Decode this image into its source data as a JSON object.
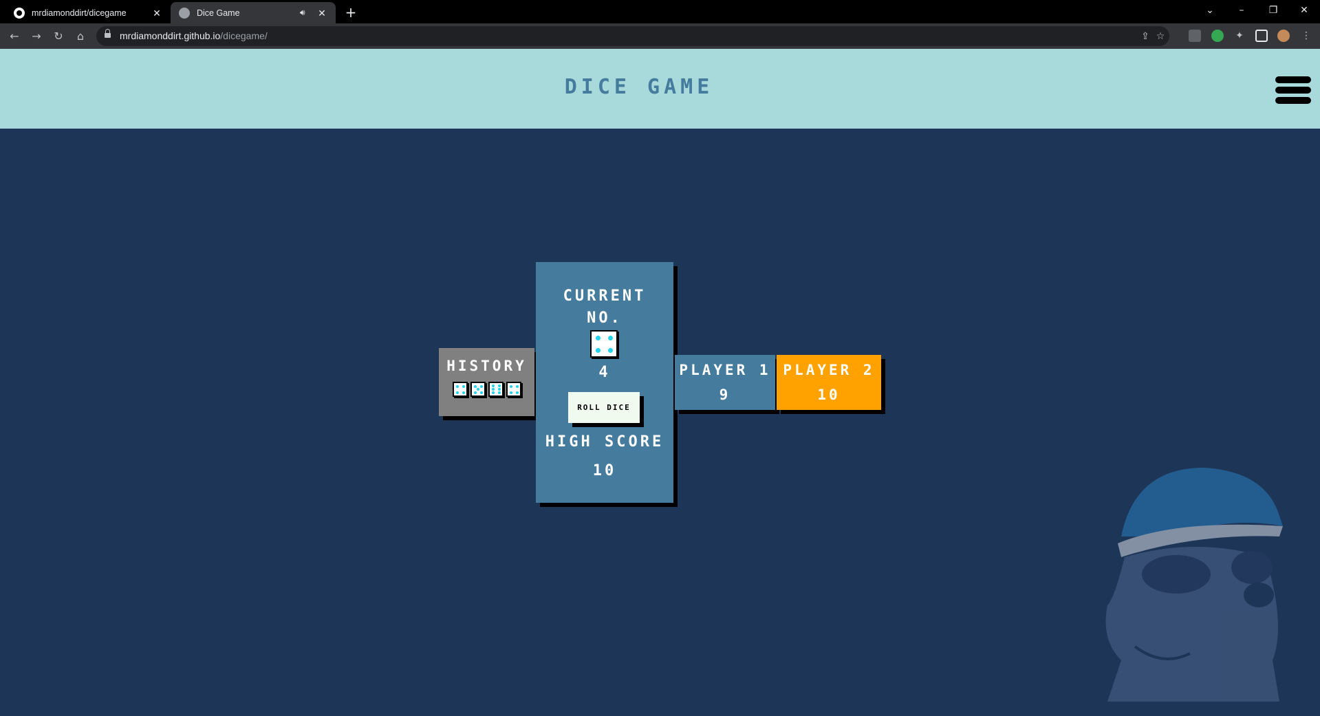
{
  "browser": {
    "tabs": [
      {
        "title": "mrdiamonddirt/dicegame",
        "favicon": "github-icon",
        "active": false
      },
      {
        "title": "Dice Game",
        "favicon": "globe-icon",
        "active": true,
        "audio": true
      }
    ],
    "url": {
      "host": "mrdiamonddirt.github.io",
      "path": "/dicegame/"
    }
  },
  "header": {
    "title": "DICE GAME",
    "menu_icon": "hamburger-icon",
    "background": "#a8dadc",
    "title_color": "#457b9d"
  },
  "game": {
    "history": {
      "label": "HISTORY",
      "dice_values": [
        4,
        5,
        6,
        4
      ]
    },
    "current": {
      "label_line1": "CURRENT",
      "label_line2": "NO.",
      "die_value": 4,
      "number": "4",
      "roll_button": "ROLL DICE",
      "high_score_label": "HIGH SCORE",
      "high_score": "10"
    },
    "players": [
      {
        "name": "PLAYER 1",
        "score": "9",
        "color": "#457b9d",
        "active": false
      },
      {
        "name": "PLAYER 2",
        "score": "10",
        "color": "#ffa200",
        "active": true
      }
    ]
  },
  "colors": {
    "page_bg": "#1d3557",
    "history_bg": "#808080",
    "panel_bg": "#457b9d",
    "pip": "#22d3ee"
  }
}
